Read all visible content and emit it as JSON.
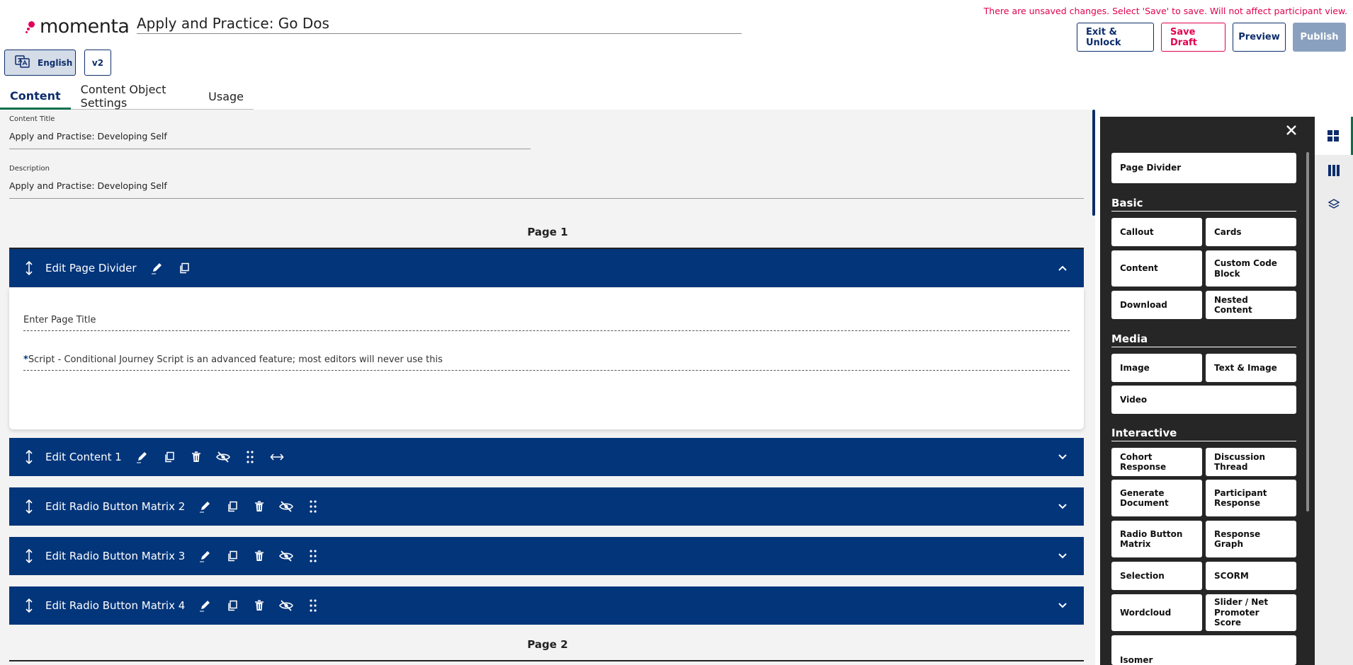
{
  "header": {
    "brand": "momenta",
    "doc_title": "Apply and Practice: Go Dos",
    "unsaved_notice": "There are unsaved changes. Select 'Save' to save. Will not affect participant view.",
    "buttons": {
      "exit": "Exit & Unlock",
      "save_draft": "Save Draft",
      "preview": "Preview",
      "publish": "Publish"
    },
    "language": "English",
    "version": "v2"
  },
  "tabs": [
    {
      "label": "Content",
      "active": true
    },
    {
      "label": "Content Object Settings",
      "active": false
    },
    {
      "label": "Usage",
      "active": false
    }
  ],
  "form": {
    "title_label": "Content Title",
    "title_value": "Apply and Practise: Developing Self",
    "desc_label": "Description",
    "desc_value": "Apply and Practise: Developing Self"
  },
  "pages": {
    "page1": "Page 1",
    "page2": "Page 2"
  },
  "page_divider": {
    "title": "Edit Page Divider",
    "page_title_placeholder": "Enter Page Title",
    "script_asterisk": "*",
    "script_label": "Script - Conditional Journey Script is an advanced feature; most editors will never use this"
  },
  "blocks": [
    {
      "title": "Edit Content 1"
    },
    {
      "title": "Edit Radio Button Matrix 2"
    },
    {
      "title": "Edit Radio Button Matrix 3"
    },
    {
      "title": "Edit Radio Button Matrix 4"
    }
  ],
  "sidebar": {
    "page_divider": "Page Divider",
    "basic_heading": "Basic",
    "basic": [
      "Callout",
      "Cards",
      "Content",
      "Custom Code Block",
      "Download",
      "Nested Content"
    ],
    "media_heading": "Media",
    "media": [
      "Image",
      "Text & Image",
      "Video"
    ],
    "interactive_heading": "Interactive",
    "interactive": [
      "Cohort Response",
      "Discussion Thread",
      "Generate Document",
      "Participant Response",
      "Radio Button Matrix",
      "Response Graph",
      "Selection",
      "SCORM",
      "Wordcloud",
      "Slider / Net Promoter Score",
      "Isomer"
    ]
  },
  "colors": {
    "navy": "#03357a",
    "accent_pink": "#e2004f",
    "green": "#0a6f4a",
    "sidebar_bg": "#262626"
  }
}
